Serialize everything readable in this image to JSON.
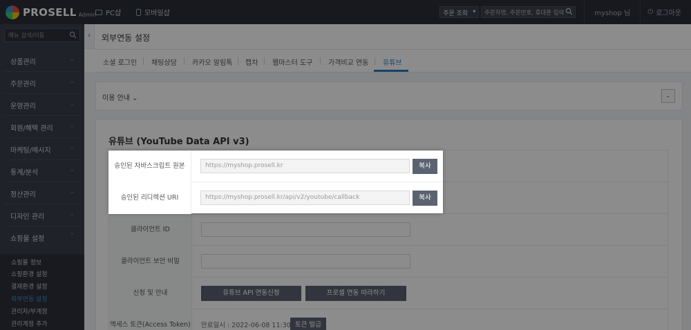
{
  "topbar": {
    "logo_text": "PROSELL",
    "logo_sub": "Admin",
    "nav_pc": "PC샵",
    "nav_mobile": "모바일샵",
    "order_select": "주문 조회",
    "search_placeholder": "주문자명, 주문번호, 휴대폰 입력",
    "user": "myshop 님",
    "logout": "로그아웃"
  },
  "sidebar": {
    "search_placeholder": "메뉴 검색/이동",
    "items": [
      "상품관리",
      "주문관리",
      "운영관리",
      "회원/혜택 관리",
      "마케팅/메시지",
      "통계/분석",
      "정산관리",
      "디자인 관리",
      "쇼핑몰 설정"
    ],
    "sub_items": [
      "쇼핑몰 정보",
      "쇼핑환경 설정",
      "결제환경 설정",
      "외부연동 설정",
      "관리자/부계정",
      "관리계정 추가"
    ],
    "active_sub": "외부연동 설정"
  },
  "page": {
    "title": "외부연동 설정",
    "tabs": [
      "소셜 로그인",
      "채팅상담",
      "카카오 알림톡",
      "캡차",
      "웹마스터 도구",
      "가격비교 연동",
      "유튜브"
    ],
    "active_tab": "유튜브",
    "usage_label": "이용 안내"
  },
  "youtube": {
    "title": "유튜브 (YouTube Data API v3)",
    "js_origin_label": "승인된 자바스크립트 원본",
    "js_origin_value": "https://myshop.prosell.kr",
    "redirect_label": "승인된 리디렉션 URI",
    "redirect_value": "https://myshop.prosell.kr/api/v2/youtube/callback",
    "copy_label": "복사",
    "client_id_label": "클라이언트 ID",
    "client_id_value": "",
    "client_secret_label": "클라이언트 보안 비밀",
    "client_secret_value": "",
    "apply_label": "신청 및 안내",
    "apply_btn": "유튜브 API 연동신청",
    "guide_btn": "프로셀 연동 따라하기",
    "token_label": "액세스 토큰(Access Token)",
    "token_text": "만료일시 : 2022-06-08 11:30",
    "token_btn": "토큰 발급"
  }
}
